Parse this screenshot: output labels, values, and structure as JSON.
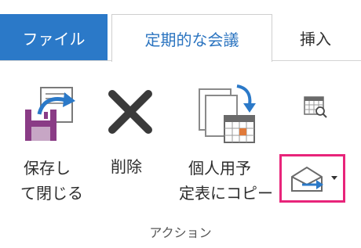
{
  "tabs": {
    "file": "ファイル",
    "meeting": "定期的な会議",
    "insert": "挿入"
  },
  "actions": {
    "save_close_line1": "保存し",
    "save_close_line2": "て閉じる",
    "delete": "削除",
    "copy_line1": "個人用予",
    "copy_line2": "定表にコピー"
  },
  "group": {
    "label": "アクション"
  },
  "colors": {
    "accent": "#2b79c8",
    "highlight": "#e8247a",
    "icon_purple": "#8a3c86"
  }
}
